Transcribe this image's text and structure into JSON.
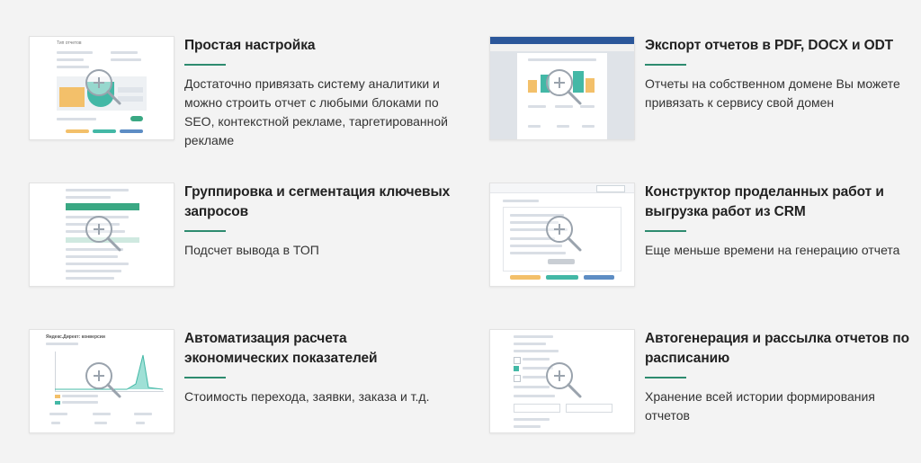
{
  "features": [
    {
      "title": "Простая настройка",
      "description": "Достаточно привязать систему аналитики и можно строить отчет с любыми блоками по SEO, контекстной рекламе, таргетированной рекламе",
      "thumb_caption": "Тип отчетов"
    },
    {
      "title": "Экспорт отчетов в PDF, DOCX и ODT",
      "description": "Отчеты на собственном домене Вы можете привязать к сервису свой домен"
    },
    {
      "title": "Группировка и сегментация ключевых запросов",
      "description": "Подсчет вывода в ТОП"
    },
    {
      "title": "Конструктор проделанных работ и выгрузка работ из CRM",
      "description": "Еще меньше времени на генерацию отчета"
    },
    {
      "title": "Автоматизация расчета экономических показателей",
      "description": "Стоимость перехода, заявки, заказа и т.д.",
      "thumb_caption": "Яндекс.Директ: конверсии"
    },
    {
      "title": "Автогенерация и рассылка отчетов по расписанию",
      "description": "Хранение всей истории формирования отчетов"
    }
  ],
  "icons": {
    "zoom": "zoom-in-icon"
  },
  "colors": {
    "accent": "#2d8b6f",
    "chart_yellow": "#f3c06a",
    "chart_teal": "#43b8a6",
    "word_blue": "#2b579a"
  }
}
